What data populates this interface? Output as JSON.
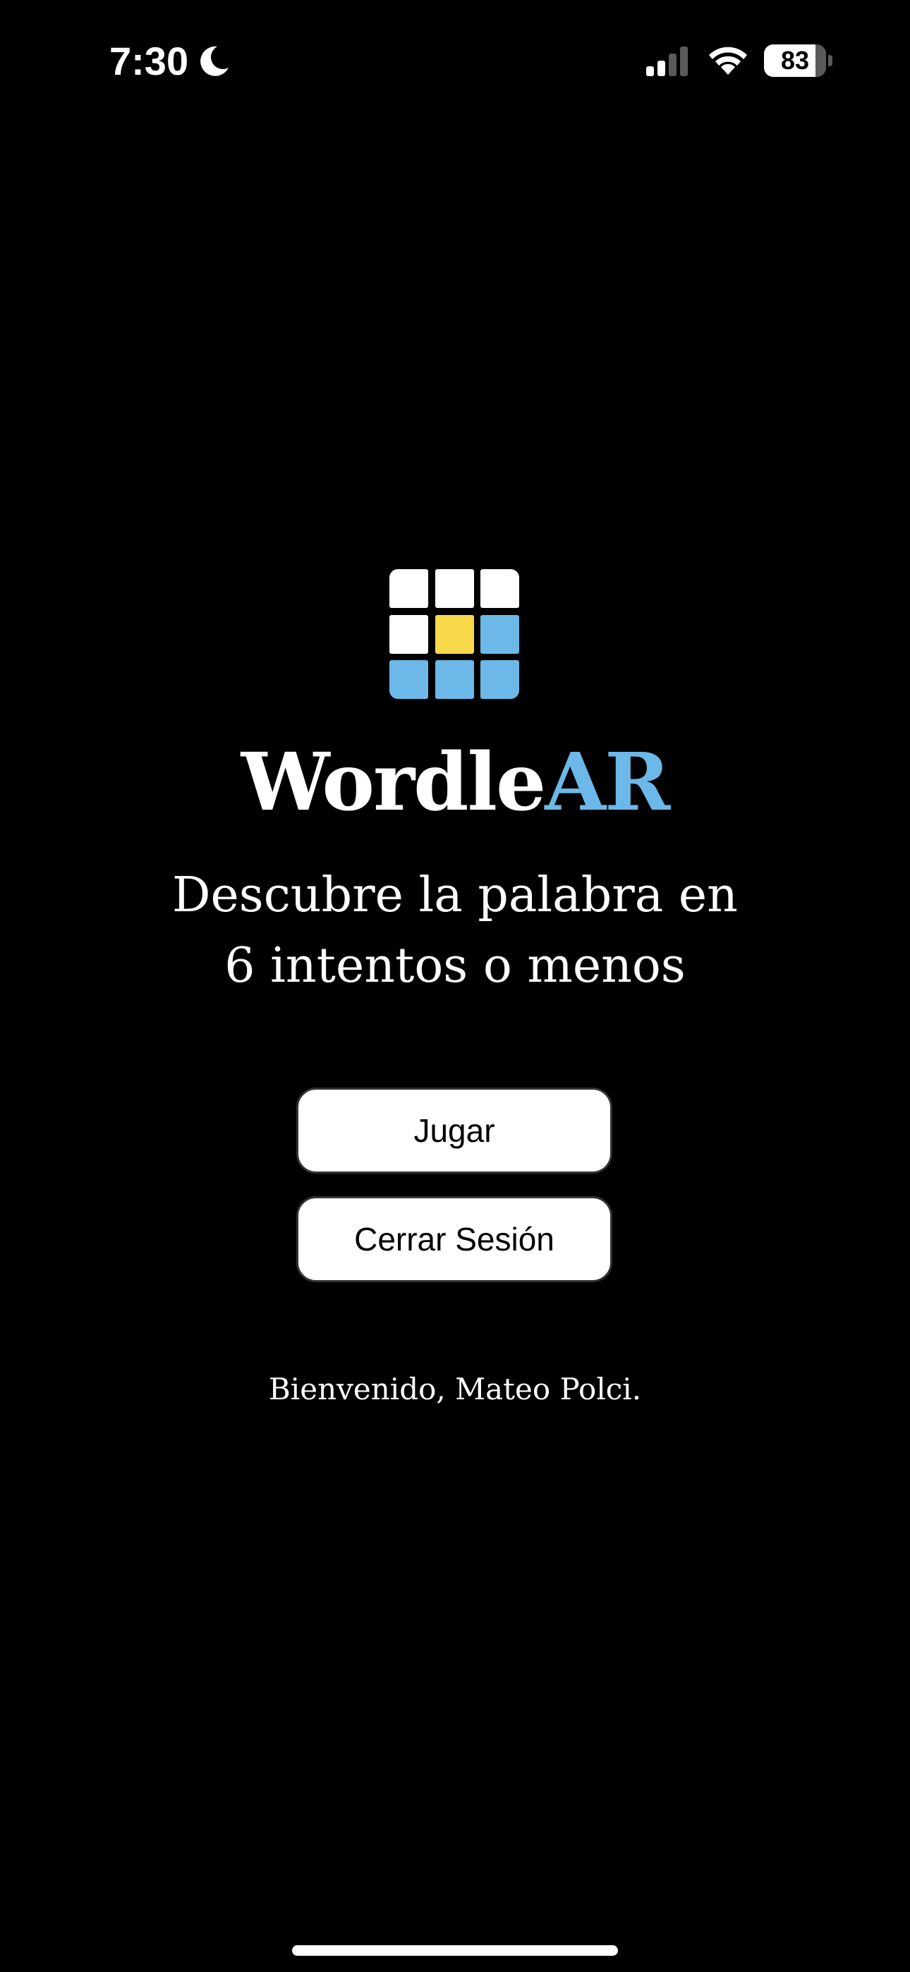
{
  "status_bar": {
    "time": "7:30",
    "battery_level": "83",
    "battery_fraction": 0.83,
    "signal_bars_active": 2,
    "icons": [
      "moon-icon",
      "signal-icon",
      "wifi-icon",
      "battery-icon"
    ]
  },
  "logo": {
    "tiles": [
      "#ffffff",
      "#ffffff",
      "#ffffff",
      "#ffffff",
      "#f7d94a",
      "#6cb8e8",
      "#6cb8e8",
      "#6cb8e8",
      "#6cb8e8"
    ]
  },
  "title": {
    "part1": "Wordle",
    "part2": "AR",
    "accent_color": "#6cb8e8"
  },
  "tagline": {
    "line1": "Descubre la palabra en",
    "line2": "6 intentos o menos"
  },
  "buttons": {
    "play_label": "Jugar",
    "logout_label": "Cerrar Sesión"
  },
  "welcome": {
    "text": "Bienvenido, Mateo Polci."
  },
  "colors": {
    "background": "#000000",
    "text": "#ffffff",
    "button_bg": "#ffffff",
    "button_text": "#000000"
  }
}
